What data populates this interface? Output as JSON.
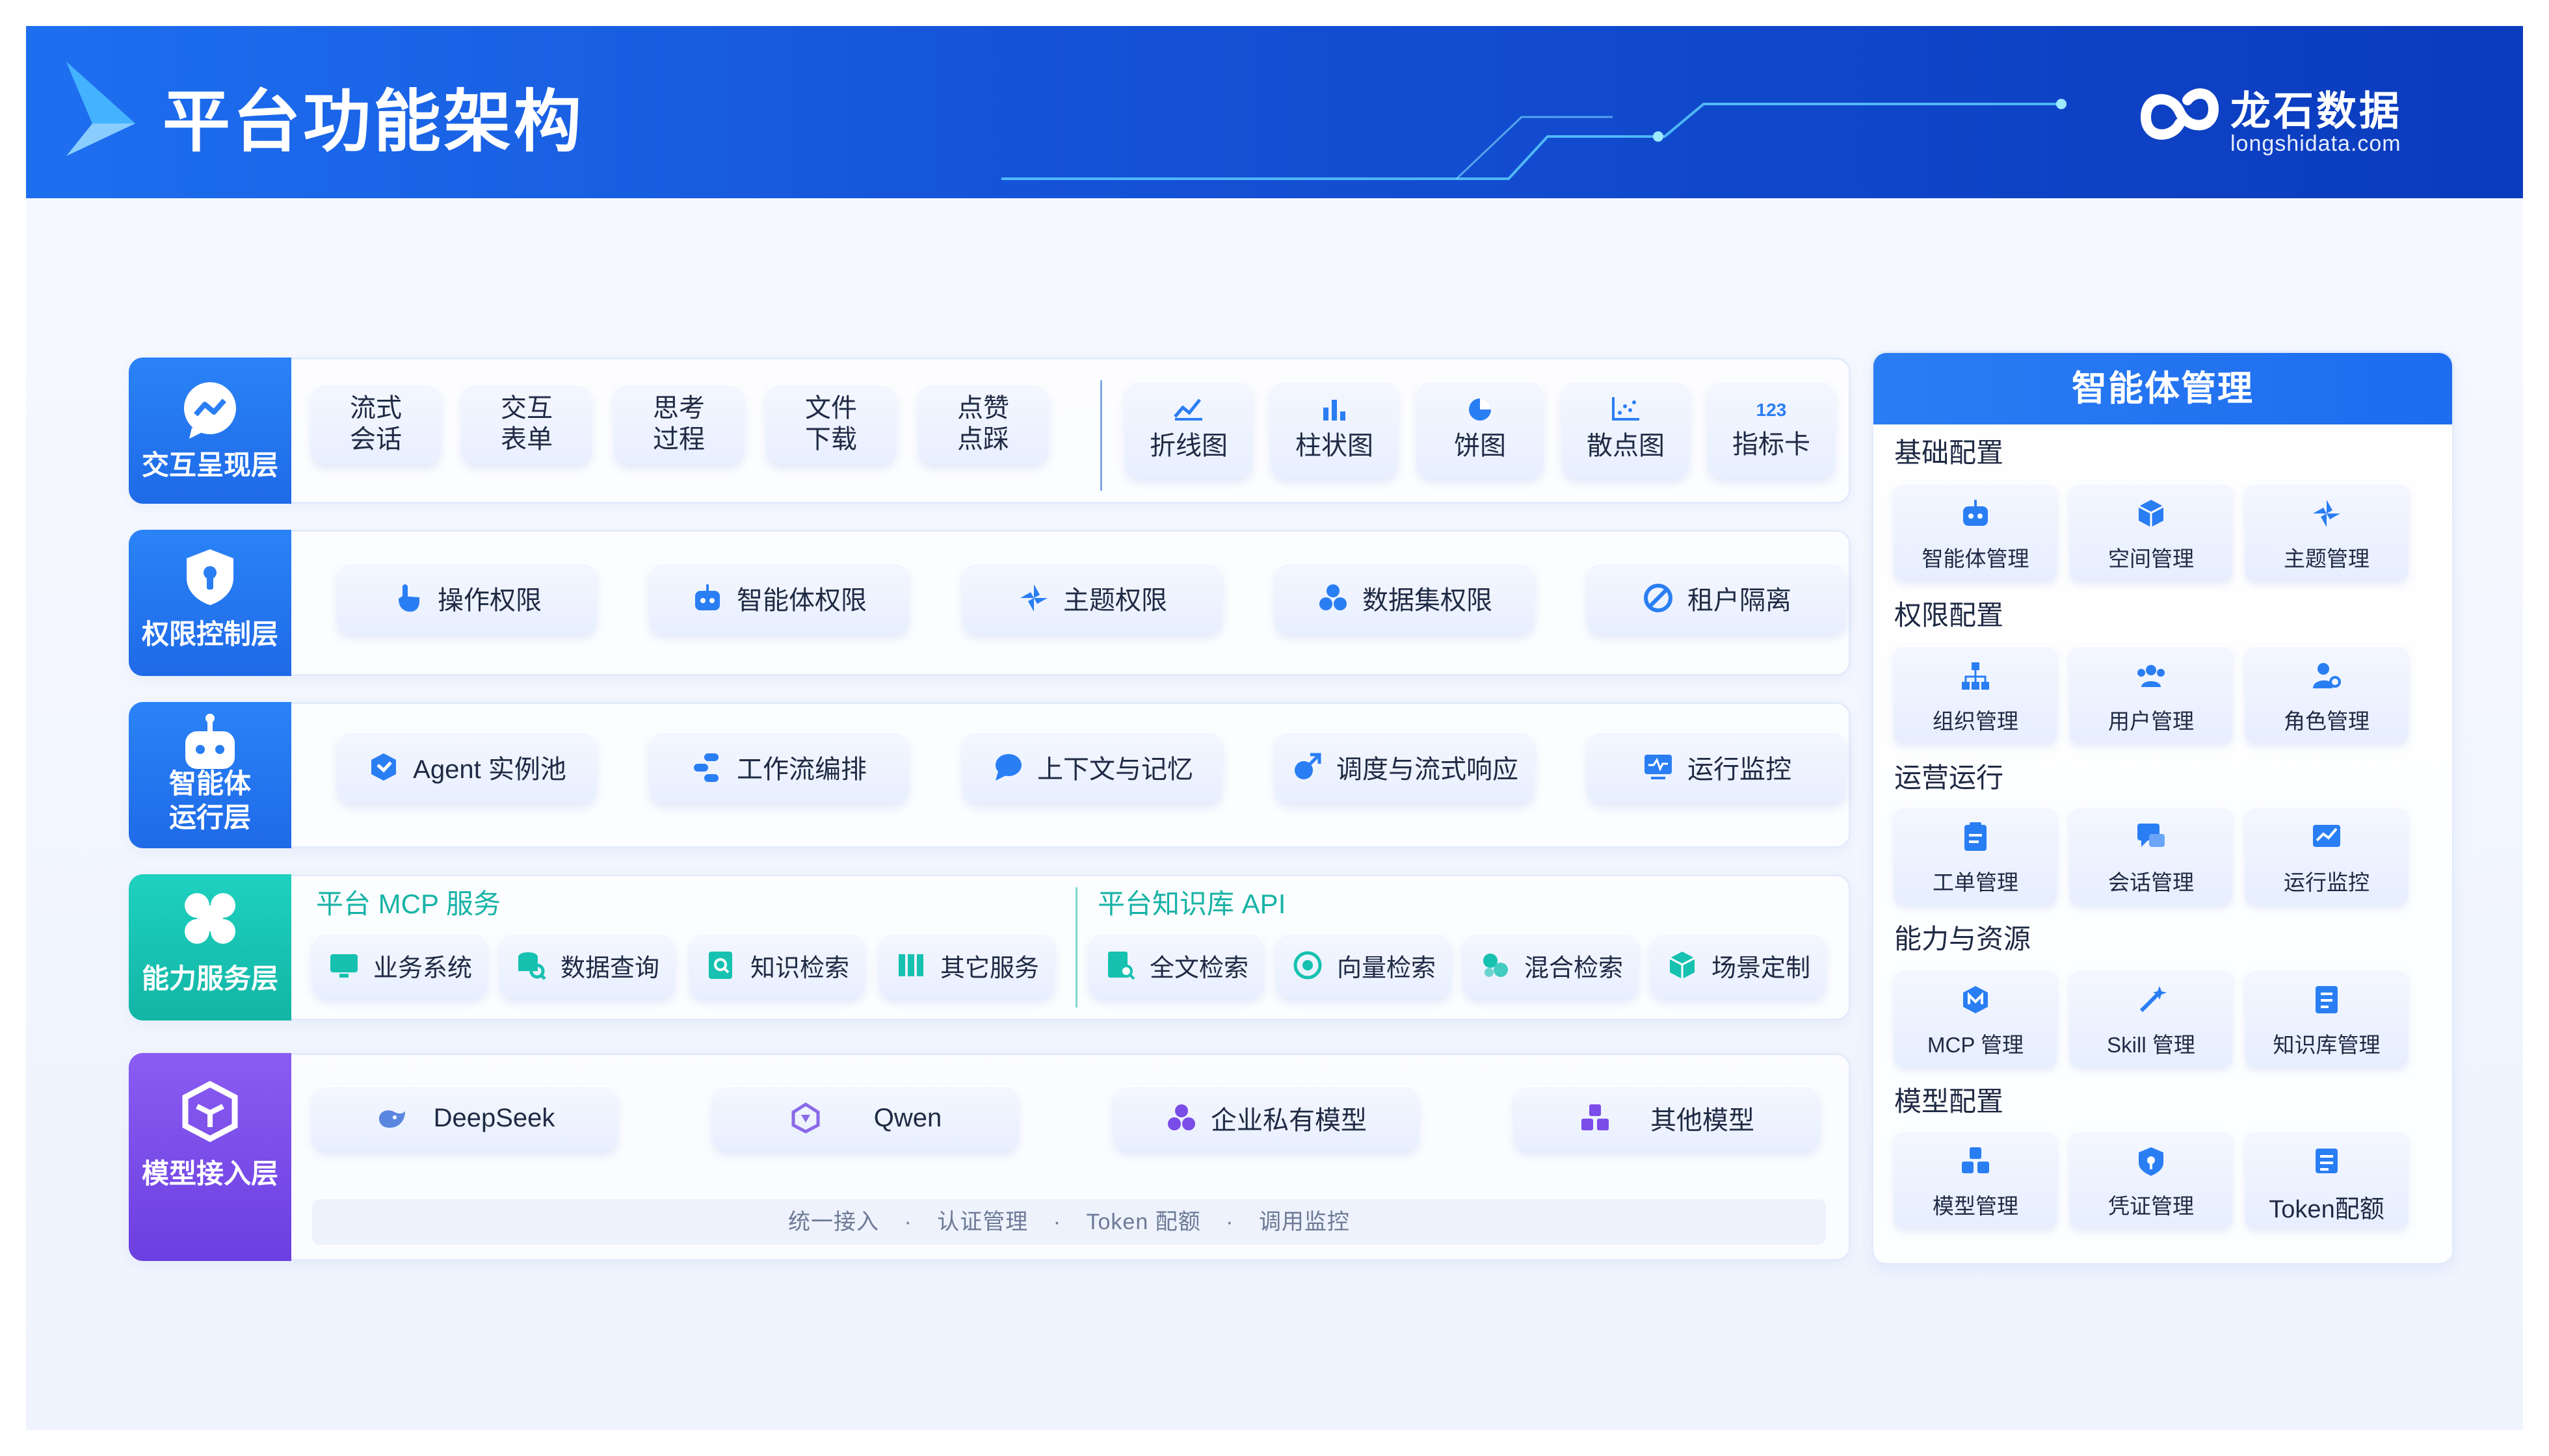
{
  "header": {
    "title": "平台功能架构"
  },
  "brand": {
    "name": "龙石数据",
    "site": "longshidata.com"
  },
  "colors": {
    "blue": "#1e6ff0",
    "teal": "#16c1b0",
    "purple": "#7a4ce8",
    "text": "#1f2a44"
  },
  "layers": {
    "interaction": {
      "label": "交互呈现层",
      "items": [
        {
          "l1": "流式",
          "l2": "会话"
        },
        {
          "l1": "交互",
          "l2": "表单"
        },
        {
          "l1": "思考",
          "l2": "过程"
        },
        {
          "l1": "文件",
          "l2": "下载"
        },
        {
          "l1": "点赞",
          "l2": "点踩"
        }
      ],
      "charts": [
        "折线图",
        "柱状图",
        "饼图",
        "散点图",
        "指标卡"
      ],
      "metric_glyph": "123"
    },
    "permission": {
      "label": "权限控制层",
      "items": [
        "操作权限",
        "智能体权限",
        "主题权限",
        "数据集权限",
        "租户隔离"
      ]
    },
    "runtime": {
      "label_l1": "智能体",
      "label_l2": "运行层",
      "items": [
        "Agent 实例池",
        "工作流编排",
        "上下文与记忆",
        "调度与流式响应",
        "运行监控"
      ]
    },
    "service": {
      "label": "能力服务层",
      "mcp_title": "平台 MCP 服务",
      "mcp_items": [
        "业务系统",
        "数据查询",
        "知识检索",
        "其它服务"
      ],
      "kb_title": "平台知识库 API",
      "kb_items": [
        "全文检索",
        "向量检索",
        "混合检索",
        "场景定制"
      ]
    },
    "model": {
      "label": "模型接入层",
      "items": [
        "DeepSeek",
        "Qwen",
        "企业私有模型",
        "其他模型"
      ],
      "notes": [
        "统一接入",
        "认证管理",
        "Token 配额",
        "调用监控"
      ]
    }
  },
  "right_panel": {
    "title": "智能体管理",
    "sections": [
      {
        "title": "基础配置",
        "items": [
          "智能体管理",
          "空间管理",
          "主题管理"
        ]
      },
      {
        "title": "权限配置",
        "items": [
          "组织管理",
          "用户管理",
          "角色管理"
        ]
      },
      {
        "title": "运营运行",
        "items": [
          "工单管理",
          "会话管理",
          "运行监控"
        ]
      },
      {
        "title": "能力与资源",
        "items": [
          "MCP 管理",
          "Skill 管理",
          "知识库管理"
        ]
      },
      {
        "title": "模型配置",
        "items": [
          "模型管理",
          "凭证管理",
          "Token配额"
        ]
      }
    ]
  }
}
